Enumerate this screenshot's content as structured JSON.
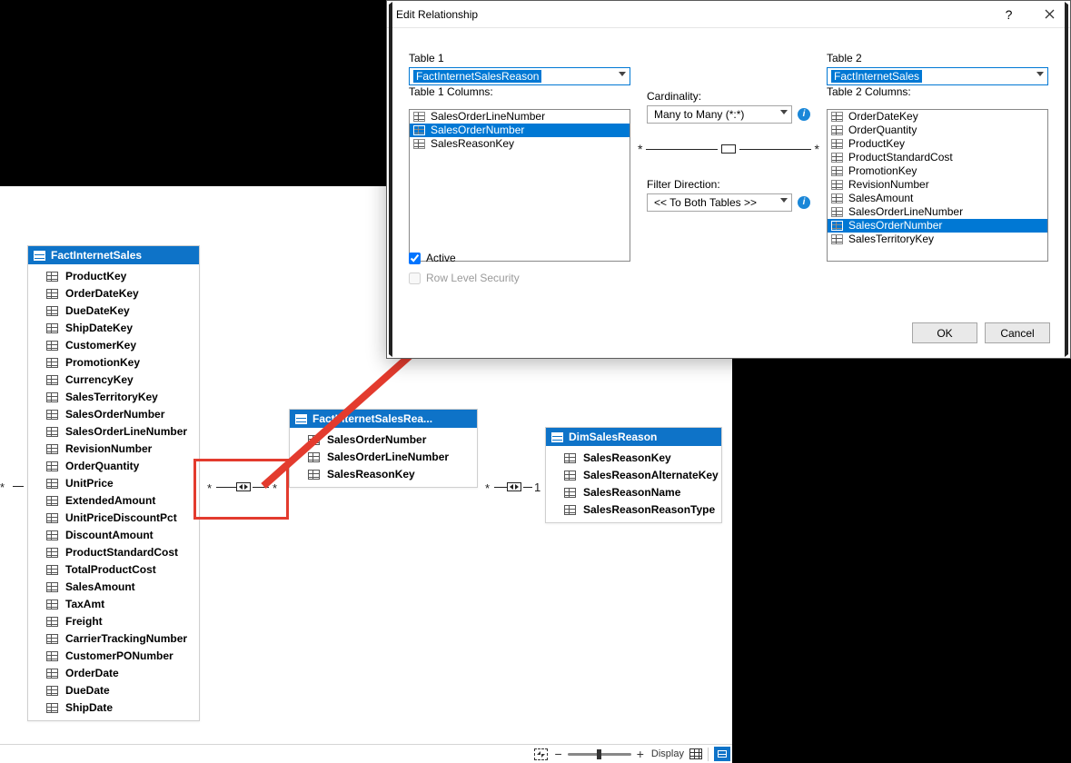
{
  "dialog": {
    "title": "Edit Relationship",
    "table1_label": "Table 1",
    "table2_label": "Table 2",
    "table1_value": "FactInternetSalesReason",
    "table2_value": "FactInternetSales",
    "table1_cols_label": "Table 1 Columns:",
    "table2_cols_label": "Table 2 Columns:",
    "table1_cols": [
      "SalesOrderLineNumber",
      "SalesOrderNumber",
      "SalesReasonKey"
    ],
    "table1_sel_index": 1,
    "table2_cols": [
      "OrderDateKey",
      "OrderQuantity",
      "ProductKey",
      "ProductStandardCost",
      "PromotionKey",
      "RevisionNumber",
      "SalesAmount",
      "SalesOrderLineNumber",
      "SalesOrderNumber",
      "SalesTerritoryKey"
    ],
    "table2_sel_index": 8,
    "cardinality_label": "Cardinality:",
    "cardinality_value": "Many to Many (*:*)",
    "filter_label": "Filter Direction:",
    "filter_value": "<< To Both Tables >>",
    "left_mark": "*",
    "right_mark": "*",
    "active_label": "Active",
    "active_checked": true,
    "rls_label": "Row Level Security",
    "rls_checked": false,
    "ok": "OK",
    "cancel": "Cancel"
  },
  "entities": {
    "fis": {
      "title": "FactInternetSales",
      "cols": [
        "ProductKey",
        "OrderDateKey",
        "DueDateKey",
        "ShipDateKey",
        "CustomerKey",
        "PromotionKey",
        "CurrencyKey",
        "SalesTerritoryKey",
        "SalesOrderNumber",
        "SalesOrderLineNumber",
        "RevisionNumber",
        "OrderQuantity",
        "UnitPrice",
        "ExtendedAmount",
        "UnitPriceDiscountPct",
        "DiscountAmount",
        "ProductStandardCost",
        "TotalProductCost",
        "SalesAmount",
        "TaxAmt",
        "Freight",
        "CarrierTrackingNumber",
        "CustomerPONumber",
        "OrderDate",
        "DueDate",
        "ShipDate"
      ]
    },
    "fisr": {
      "title": "FactInternetSalesRea...",
      "cols": [
        "SalesOrderNumber",
        "SalesOrderLineNumber",
        "SalesReasonKey"
      ]
    },
    "dsr": {
      "title": "DimSalesReason",
      "cols": [
        "SalesReasonKey",
        "SalesReasonAlternateKey",
        "SalesReasonName",
        "SalesReasonReasonType"
      ]
    }
  },
  "canvas_rel": {
    "left_left_mark": "*",
    "mm_l": "*",
    "mm_r": "*",
    "one_r": "1",
    "one_l": "*"
  },
  "statusbar": {
    "display_label": "Display",
    "zoom_thumb_pct": 50
  }
}
